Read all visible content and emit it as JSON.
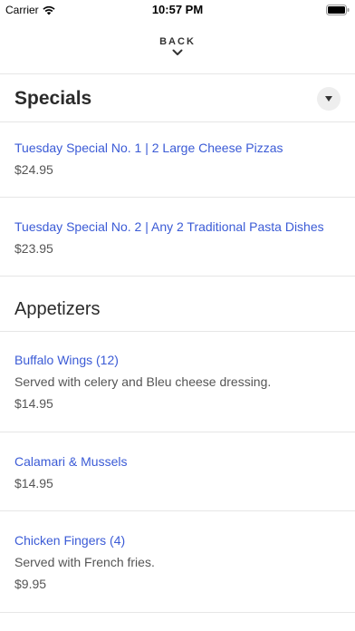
{
  "status_bar": {
    "carrier": "Carrier",
    "time": "10:57 PM",
    "icons": [
      "wifi-icon",
      "battery-icon"
    ]
  },
  "header": {
    "back_label": "BACK",
    "back_icon": "chevron-down-icon"
  },
  "sections": [
    {
      "title": "Specials",
      "collapse_icon": "caret-down-icon",
      "items": [
        {
          "name": "Tuesday Special No. 1 | 2 Large Cheese Pizzas",
          "description": "",
          "price": "$24.95"
        },
        {
          "name": "Tuesday Special No. 2 | Any 2 Traditional Pasta Dishes",
          "description": "",
          "price": "$23.95"
        }
      ]
    },
    {
      "title": "Appetizers",
      "items": [
        {
          "name": "Buffalo Wings (12)",
          "description": "Served with celery and Bleu cheese dressing.",
          "price": "$14.95"
        },
        {
          "name": "Calamari & Mussels",
          "description": "",
          "price": "$14.95"
        },
        {
          "name": "Chicken Fingers (4)",
          "description": "Served with French fries.",
          "price": "$9.95"
        }
      ]
    }
  ],
  "colors": {
    "item_name": "#3b5bd6",
    "divider": "#e6e6e6",
    "text": "#333333"
  }
}
